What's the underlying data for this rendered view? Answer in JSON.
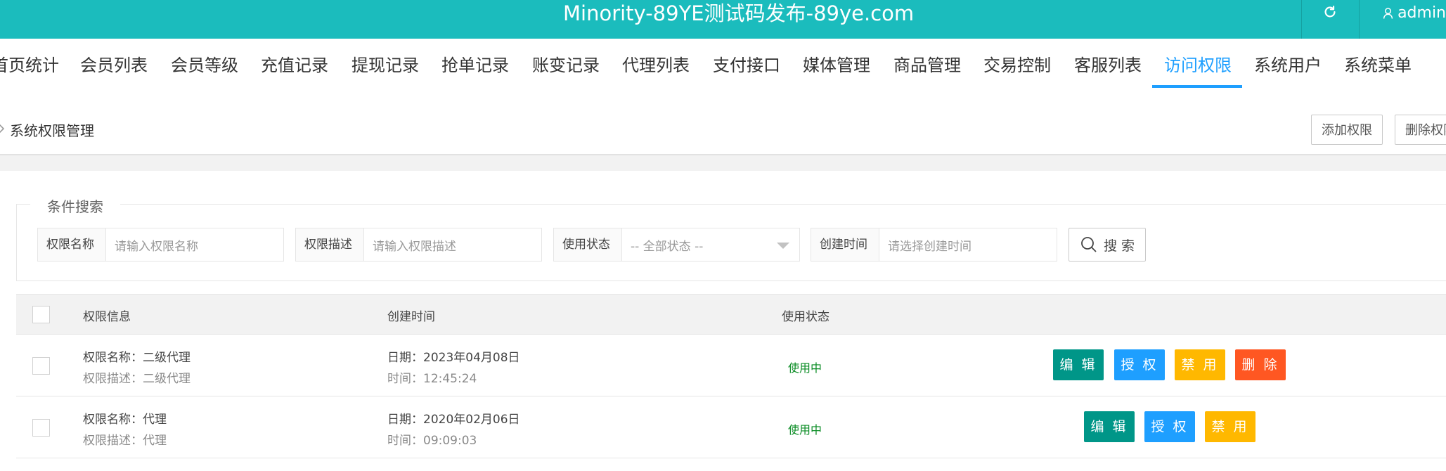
{
  "header": {
    "title": "Minority-89YE测试码发布-89ye.com",
    "user": "admin",
    "refresh_icon": "refresh-icon",
    "user_icon": "user-icon",
    "bg_color": "#1bbcbd"
  },
  "nav": {
    "items": [
      "首页统计",
      "会员列表",
      "会员等级",
      "充值记录",
      "提现记录",
      "抢单记录",
      "账变记录",
      "代理列表",
      "支付接口",
      "媒体管理",
      "商品管理",
      "交易控制",
      "客服列表",
      "访问权限",
      "系统用户",
      "系统菜单"
    ],
    "active": "访问权限",
    "active_color": "#1e9fff"
  },
  "breadcrumb": {
    "title": "系统权限管理",
    "add_button": "添加权限",
    "delete_button": "删除权限"
  },
  "search": {
    "legend": "条件搜索",
    "fields": [
      {
        "label": "权限名称",
        "placeholder": "请输入权限名称"
      },
      {
        "label": "权限描述",
        "placeholder": "请输入权限描述"
      },
      {
        "label": "使用状态",
        "selected": "-- 全部状态 --"
      },
      {
        "label": "创建时间",
        "placeholder": "请选择创建时间"
      }
    ],
    "button": "搜 索"
  },
  "table": {
    "headers": [
      "权限信息",
      "创建时间",
      "使用状态"
    ],
    "rows": [
      {
        "name": "权限名称：二级代理",
        "desc": "权限描述：二级代理",
        "date": "日期：2023年04月08日",
        "time": "时间：12:45:24",
        "status": "使用中",
        "actions": [
          "编 辑",
          "授 权",
          "禁 用",
          "删 除"
        ]
      },
      {
        "name": "权限名称：代理",
        "desc": "权限描述：代理",
        "date": "日期：2020年02月06日",
        "time": "时间：09:09:03",
        "status": "使用中",
        "actions": [
          "编 辑",
          "授 权",
          "禁 用"
        ]
      }
    ],
    "action_colors": {
      "edit": "#009688",
      "auth": "#1e9fff",
      "disable": "#ffb800",
      "delete": "#ff5722"
    },
    "status_color": "#0a8c24"
  }
}
